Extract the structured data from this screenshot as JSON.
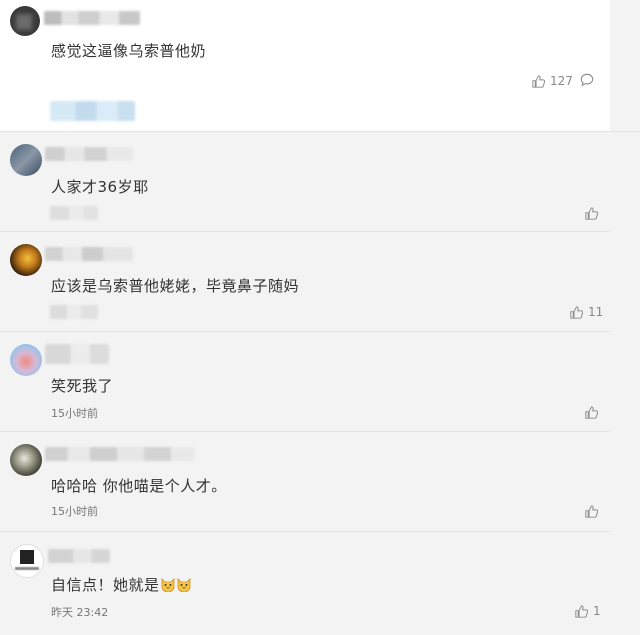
{
  "top_comment": {
    "text": "感觉这逼像乌索普他奶",
    "like_count": "127"
  },
  "replies": [
    {
      "text": "人家才36岁耶",
      "time": "",
      "like_count": ""
    },
    {
      "text": "应该是乌索普他姥姥，毕竟鼻子随妈",
      "time": "",
      "like_count": "11"
    },
    {
      "text": "笑死我了",
      "time": "15小时前",
      "like_count": ""
    },
    {
      "text": "哈哈哈 你他喵是个人才。",
      "time": "15小时前",
      "like_count": ""
    },
    {
      "text": "自信点！她就是",
      "time": "昨天 23:42",
      "like_count": "1"
    }
  ],
  "icons": {
    "like": "thumbs-up-icon",
    "reply": "comment-bubble-icon",
    "emoji": "cat-face-emoji-icon"
  },
  "colors": {
    "page_bg": "#ffffff",
    "reply_bg": "#f3f3f3",
    "text": "#333333",
    "muted": "#888888"
  }
}
